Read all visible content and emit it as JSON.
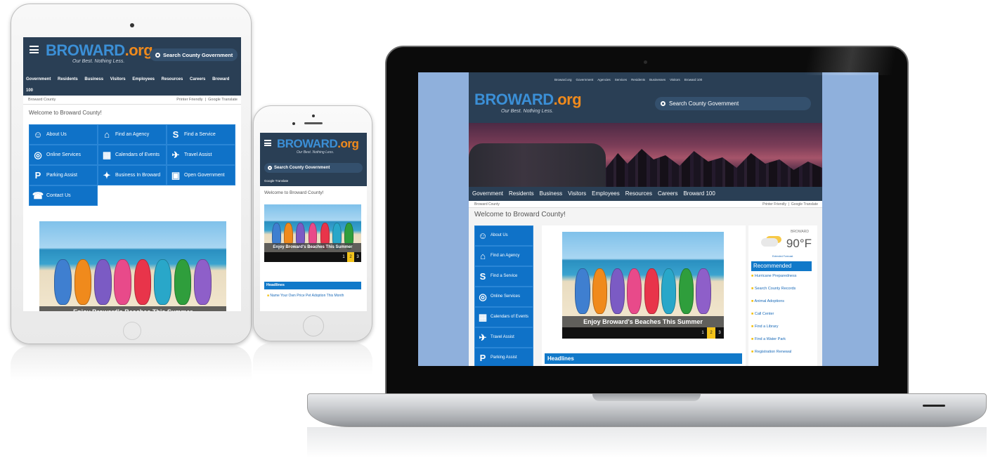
{
  "brand": {
    "logo_text": "BROWARD",
    "logo_suffix": ".org",
    "tagline": "Our Best. Nothing Less."
  },
  "search": {
    "label": "Search County Government"
  },
  "site": {
    "top_links": [
      "Broward.org",
      "Government",
      "Agencies",
      "Services",
      "Residents",
      "Businesses",
      "Visitors",
      "Broward 100"
    ],
    "nav": [
      "Government",
      "Residents",
      "Business",
      "Visitors",
      "Employees",
      "Resources",
      "Careers",
      "Broward 100"
    ],
    "breadcrumb": "Broward County",
    "printer_friendly": "Printer Friendly",
    "google_translate": "Google Translate",
    "welcome": "Welcome to Broward County!",
    "slide_caption": "Enjoy Broward's Beaches This Summer",
    "pager": [
      "1",
      "2",
      "3"
    ],
    "headlines_label": "Headlines",
    "headline_item": "Name Your Own Price Pet Adoption This Month"
  },
  "tablet_tiles": [
    {
      "icon": "people-icon",
      "label": "About Us"
    },
    {
      "icon": "agency-icon",
      "label": "Find an Agency"
    },
    {
      "icon": "service-icon",
      "label": "Find a Service"
    },
    {
      "icon": "globe-icon",
      "label": "Online Services"
    },
    {
      "icon": "calendar-icon",
      "label": "Calendars of Events"
    },
    {
      "icon": "plane-icon",
      "label": "Travel Assist"
    },
    {
      "icon": "parking-icon",
      "label": "Parking Assist"
    },
    {
      "icon": "handshake-icon",
      "label": "Business In Broward"
    },
    {
      "icon": "building-icon",
      "label": "Open Government"
    },
    {
      "icon": "phone-icon",
      "label": "Contact Us"
    }
  ],
  "laptop_tiles": [
    {
      "icon": "people-icon",
      "label": "About Us"
    },
    {
      "icon": "agency-icon",
      "label": "Find an Agency"
    },
    {
      "icon": "service-icon",
      "label": "Find a Service"
    },
    {
      "icon": "globe-icon",
      "label": "Online Services"
    },
    {
      "icon": "calendar-icon",
      "label": "Calendars of Events"
    },
    {
      "icon": "plane-icon",
      "label": "Travel Assist"
    },
    {
      "icon": "parking-icon",
      "label": "Parking Assist"
    }
  ],
  "weather": {
    "location": "BROWARD",
    "temp": "90°F",
    "forecast_link": "Extended Forecast"
  },
  "recommended": {
    "title": "Recommended",
    "items": [
      "Hurricane Preparedness",
      "Search County Records",
      "Animal Adoptions",
      "Call Center",
      "Find a Library",
      "Find a Water Park",
      "Registration Renewal"
    ]
  },
  "colors": {
    "header_navy": "#2a3f55",
    "tile_blue": "#0f72c8",
    "logo_blue": "#3b8fd6",
    "logo_orange": "#f08a1c",
    "pager_active": "#f2c21b"
  }
}
